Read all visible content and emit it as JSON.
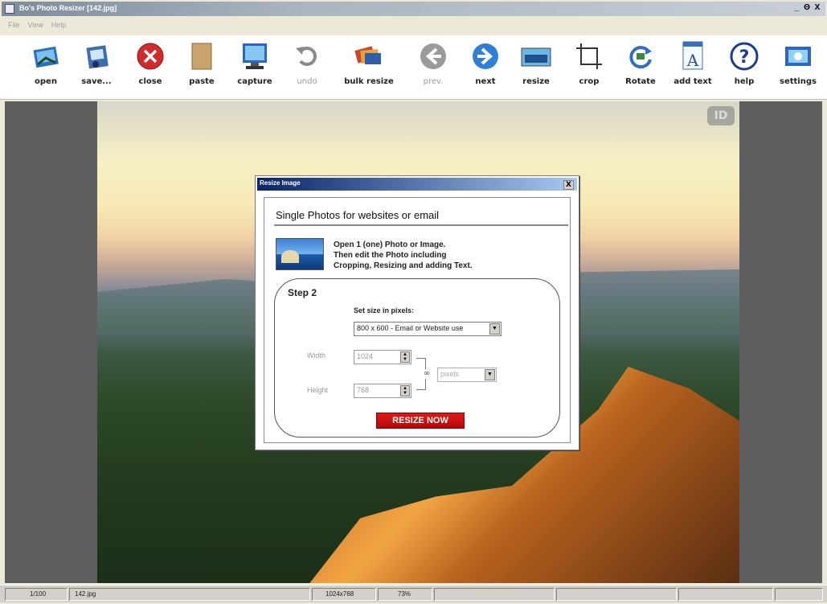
{
  "window": {
    "title": "Bo's Photo Resizer [142.jpg]",
    "min": "_",
    "max": "Θ",
    "close": "X"
  },
  "menu": [
    "File",
    "View",
    "Help"
  ],
  "toolbar": [
    {
      "label": "open",
      "icon": "open-photo-icon",
      "enabled": true
    },
    {
      "label": "save...",
      "icon": "save-icon",
      "enabled": true
    },
    {
      "label": "close",
      "icon": "close-red-icon",
      "enabled": true
    },
    {
      "label": "paste",
      "icon": "paste-icon",
      "enabled": true
    },
    {
      "label": "capture",
      "icon": "monitor-icon",
      "enabled": true
    },
    {
      "label": "undo",
      "icon": "undo-icon",
      "enabled": false
    },
    {
      "label": "bulk resize",
      "icon": "bulk-resize-icon",
      "enabled": true
    },
    {
      "label": "prev.",
      "icon": "prev-arrow-icon",
      "enabled": false
    },
    {
      "label": "next",
      "icon": "next-arrow-icon",
      "enabled": true
    },
    {
      "label": "resize",
      "icon": "resize-icon",
      "enabled": true
    },
    {
      "label": "crop",
      "icon": "crop-icon",
      "enabled": true
    },
    {
      "label": "Rotate",
      "icon": "rotate-icon",
      "enabled": true
    },
    {
      "label": "add text",
      "icon": "add-text-icon",
      "enabled": true
    },
    {
      "label": "help",
      "icon": "help-icon",
      "enabled": true
    },
    {
      "label": "settings",
      "icon": "settings-icon",
      "enabled": true
    }
  ],
  "photo": {
    "watermark": "ID"
  },
  "dialog": {
    "title": "Resize Image",
    "close": "X",
    "heading": "Single Photos for websites or email",
    "desc1": "Open 1 (one) Photo or Image.",
    "desc2": "Then edit the Photo including",
    "desc3": "Cropping, Resizing and adding Text.",
    "step_title": "Step 2",
    "set_size_label": "Set size in pixels:",
    "preset_value": "800 x 600 - Email or Website use",
    "width_label": "Width",
    "width_value": "1024",
    "height_label": "Height",
    "height_value": "768",
    "unit_value": "pixels",
    "resize_button": "RESIZE NOW"
  },
  "status": {
    "index": "1/100",
    "file": "142.jpg",
    "dimensions": "1024x768",
    "zoom": "73%"
  }
}
